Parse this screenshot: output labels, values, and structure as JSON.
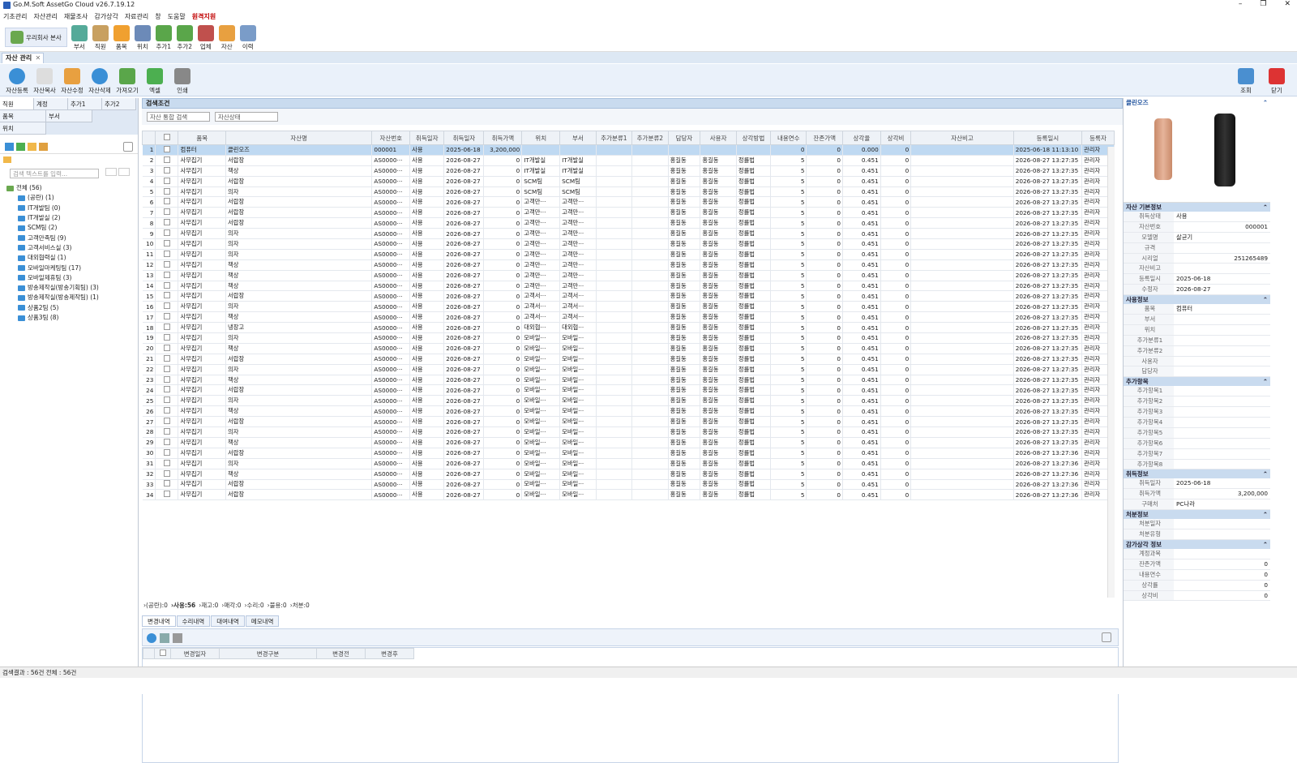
{
  "app": {
    "title": "Go.M.Soft AssetGo Cloud v26.7.19.12"
  },
  "menu": [
    "기초관리",
    "자산관리",
    "재물조사",
    "감가상각",
    "자료관리",
    "창",
    "도움말",
    "원격지원"
  ],
  "toolbar": {
    "company": "우리회사 본사",
    "items": [
      "부서",
      "직원",
      "품목",
      "위치",
      "추가1",
      "추가2",
      "업체",
      "자산",
      "이력"
    ]
  },
  "doc_tab": "자산 관리",
  "sub_toolbar": [
    "자산등록",
    "자산복사",
    "자산수정",
    "자산삭제",
    "가져오기",
    "엑셀",
    "인쇄"
  ],
  "sub_right": [
    "조회",
    "닫기"
  ],
  "left": {
    "tabs": [
      "직원",
      "계정",
      "추가1",
      "추가2"
    ],
    "tabs2": [
      "품목",
      "부서",
      "위치"
    ],
    "search_placeholder": "검색 텍스트를 입력...",
    "tree": [
      "전체 (56)",
      "(공란) (1)",
      "IT개발팀 (0)",
      "IT개발실 (2)",
      "SCM팀 (2)",
      "고객만족팀 (9)",
      "고객서비스실 (3)",
      "대외협력실 (1)",
      "모바일마케팅팀 (17)",
      "모바일제휴팀 (3)",
      "방송제작실(방송기획팀) (3)",
      "방송제작실(방송제작팀) (1)",
      "상품2팀 (5)",
      "상품3팀 (8)"
    ]
  },
  "search": {
    "title": "검색조건",
    "combo1": "자산 통합 검색",
    "combo2": "자산상태"
  },
  "grid": {
    "columns": [
      "",
      "",
      "품목",
      "자산명",
      "자산번호",
      "취득일자",
      "취득일자",
      "취득가액",
      "위치",
      "부서",
      "추가분류1",
      "추가분류2",
      "담당자",
      "사용자",
      "상각방법",
      "내용연수",
      "잔존가액",
      "상각율",
      "상각비",
      "자산비고",
      "등록일시",
      "등록자"
    ],
    "rows": [
      [
        "1",
        "컴퓨터",
        "클린오즈",
        "000001",
        "사용",
        "2025-06-18",
        "3,200,000",
        "",
        "",
        "",
        "",
        "",
        "",
        "",
        "0",
        "0",
        "0.000",
        "0",
        "",
        "2025-06-18 11:13:10",
        "관리자"
      ],
      [
        "2",
        "사무집기",
        "서랍장",
        "AS0000···",
        "사용",
        "2026-08-27",
        "0",
        "IT개발실",
        "IT개발실",
        "",
        "",
        "홍길동",
        "홍길동",
        "정률법",
        "5",
        "0",
        "0.451",
        "0",
        "",
        "2026-08-27 13:27:35",
        "관리자"
      ],
      [
        "3",
        "사무집기",
        "책상",
        "AS0000···",
        "사용",
        "2026-08-27",
        "0",
        "IT개발실",
        "IT개발실",
        "",
        "",
        "홍길동",
        "홍길동",
        "정률법",
        "5",
        "0",
        "0.451",
        "0",
        "",
        "2026-08-27 13:27:35",
        "관리자"
      ],
      [
        "4",
        "사무집기",
        "서랍장",
        "AS0000···",
        "사용",
        "2026-08-27",
        "0",
        "SCM팀",
        "SCM팀",
        "",
        "",
        "홍길동",
        "홍길동",
        "정률법",
        "5",
        "0",
        "0.451",
        "0",
        "",
        "2026-08-27 13:27:35",
        "관리자"
      ],
      [
        "5",
        "사무집기",
        "의자",
        "AS0000···",
        "사용",
        "2026-08-27",
        "0",
        "SCM팀",
        "SCM팀",
        "",
        "",
        "홍길동",
        "홍길동",
        "정률법",
        "5",
        "0",
        "0.451",
        "0",
        "",
        "2026-08-27 13:27:35",
        "관리자"
      ],
      [
        "6",
        "사무집기",
        "서랍장",
        "AS0000···",
        "사용",
        "2026-08-27",
        "0",
        "고객만···",
        "고객만···",
        "",
        "",
        "홍길동",
        "홍길동",
        "정률법",
        "5",
        "0",
        "0.451",
        "0",
        "",
        "2026-08-27 13:27:35",
        "관리자"
      ],
      [
        "7",
        "사무집기",
        "서랍장",
        "AS0000···",
        "사용",
        "2026-08-27",
        "0",
        "고객만···",
        "고객만···",
        "",
        "",
        "홍길동",
        "홍길동",
        "정률법",
        "5",
        "0",
        "0.451",
        "0",
        "",
        "2026-08-27 13:27:35",
        "관리자"
      ],
      [
        "8",
        "사무집기",
        "서랍장",
        "AS0000···",
        "사용",
        "2026-08-27",
        "0",
        "고객만···",
        "고객만···",
        "",
        "",
        "홍길동",
        "홍길동",
        "정률법",
        "5",
        "0",
        "0.451",
        "0",
        "",
        "2026-08-27 13:27:35",
        "관리자"
      ],
      [
        "9",
        "사무집기",
        "의자",
        "AS0000···",
        "사용",
        "2026-08-27",
        "0",
        "고객만···",
        "고객만···",
        "",
        "",
        "홍길동",
        "홍길동",
        "정률법",
        "5",
        "0",
        "0.451",
        "0",
        "",
        "2026-08-27 13:27:35",
        "관리자"
      ],
      [
        "10",
        "사무집기",
        "의자",
        "AS0000···",
        "사용",
        "2026-08-27",
        "0",
        "고객만···",
        "고객만···",
        "",
        "",
        "홍길동",
        "홍길동",
        "정률법",
        "5",
        "0",
        "0.451",
        "0",
        "",
        "2026-08-27 13:27:35",
        "관리자"
      ],
      [
        "11",
        "사무집기",
        "의자",
        "AS0000···",
        "사용",
        "2026-08-27",
        "0",
        "고객만···",
        "고객만···",
        "",
        "",
        "홍길동",
        "홍길동",
        "정률법",
        "5",
        "0",
        "0.451",
        "0",
        "",
        "2026-08-27 13:27:35",
        "관리자"
      ],
      [
        "12",
        "사무집기",
        "책상",
        "AS0000···",
        "사용",
        "2026-08-27",
        "0",
        "고객만···",
        "고객만···",
        "",
        "",
        "홍길동",
        "홍길동",
        "정률법",
        "5",
        "0",
        "0.451",
        "0",
        "",
        "2026-08-27 13:27:35",
        "관리자"
      ],
      [
        "13",
        "사무집기",
        "책상",
        "AS0000···",
        "사용",
        "2026-08-27",
        "0",
        "고객만···",
        "고객만···",
        "",
        "",
        "홍길동",
        "홍길동",
        "정률법",
        "5",
        "0",
        "0.451",
        "0",
        "",
        "2026-08-27 13:27:35",
        "관리자"
      ],
      [
        "14",
        "사무집기",
        "책상",
        "AS0000···",
        "사용",
        "2026-08-27",
        "0",
        "고객만···",
        "고객만···",
        "",
        "",
        "홍길동",
        "홍길동",
        "정률법",
        "5",
        "0",
        "0.451",
        "0",
        "",
        "2026-08-27 13:27:35",
        "관리자"
      ],
      [
        "15",
        "사무집기",
        "서랍장",
        "AS0000···",
        "사용",
        "2026-08-27",
        "0",
        "고객서···",
        "고객서···",
        "",
        "",
        "홍길동",
        "홍길동",
        "정률법",
        "5",
        "0",
        "0.451",
        "0",
        "",
        "2026-08-27 13:27:35",
        "관리자"
      ],
      [
        "16",
        "사무집기",
        "의자",
        "AS0000···",
        "사용",
        "2026-08-27",
        "0",
        "고객서···",
        "고객서···",
        "",
        "",
        "홍길동",
        "홍길동",
        "정률법",
        "5",
        "0",
        "0.451",
        "0",
        "",
        "2026-08-27 13:27:35",
        "관리자"
      ],
      [
        "17",
        "사무집기",
        "책상",
        "AS0000···",
        "사용",
        "2026-08-27",
        "0",
        "고객서···",
        "고객서···",
        "",
        "",
        "홍길동",
        "홍길동",
        "정률법",
        "5",
        "0",
        "0.451",
        "0",
        "",
        "2026-08-27 13:27:35",
        "관리자"
      ],
      [
        "18",
        "사무집기",
        "냉장고",
        "AS0000···",
        "사용",
        "2026-08-27",
        "0",
        "대외협···",
        "대외협···",
        "",
        "",
        "홍길동",
        "홍길동",
        "정률법",
        "5",
        "0",
        "0.451",
        "0",
        "",
        "2026-08-27 13:27:35",
        "관리자"
      ],
      [
        "19",
        "사무집기",
        "의자",
        "AS0000···",
        "사용",
        "2026-08-27",
        "0",
        "모바일···",
        "모바일···",
        "",
        "",
        "홍길동",
        "홍길동",
        "정률법",
        "5",
        "0",
        "0.451",
        "0",
        "",
        "2026-08-27 13:27:35",
        "관리자"
      ],
      [
        "20",
        "사무집기",
        "책상",
        "AS0000···",
        "사용",
        "2026-08-27",
        "0",
        "모바일···",
        "모바일···",
        "",
        "",
        "홍길동",
        "홍길동",
        "정률법",
        "5",
        "0",
        "0.451",
        "0",
        "",
        "2026-08-27 13:27:35",
        "관리자"
      ],
      [
        "21",
        "사무집기",
        "서랍장",
        "AS0000···",
        "사용",
        "2026-08-27",
        "0",
        "모바일···",
        "모바일···",
        "",
        "",
        "홍길동",
        "홍길동",
        "정률법",
        "5",
        "0",
        "0.451",
        "0",
        "",
        "2026-08-27 13:27:35",
        "관리자"
      ],
      [
        "22",
        "사무집기",
        "의자",
        "AS0000···",
        "사용",
        "2026-08-27",
        "0",
        "모바일···",
        "모바일···",
        "",
        "",
        "홍길동",
        "홍길동",
        "정률법",
        "5",
        "0",
        "0.451",
        "0",
        "",
        "2026-08-27 13:27:35",
        "관리자"
      ],
      [
        "23",
        "사무집기",
        "책상",
        "AS0000···",
        "사용",
        "2026-08-27",
        "0",
        "모바일···",
        "모바일···",
        "",
        "",
        "홍길동",
        "홍길동",
        "정률법",
        "5",
        "0",
        "0.451",
        "0",
        "",
        "2026-08-27 13:27:35",
        "관리자"
      ],
      [
        "24",
        "사무집기",
        "서랍장",
        "AS0000···",
        "사용",
        "2026-08-27",
        "0",
        "모바일···",
        "모바일···",
        "",
        "",
        "홍길동",
        "홍길동",
        "정률법",
        "5",
        "0",
        "0.451",
        "0",
        "",
        "2026-08-27 13:27:35",
        "관리자"
      ],
      [
        "25",
        "사무집기",
        "의자",
        "AS0000···",
        "사용",
        "2026-08-27",
        "0",
        "모바일···",
        "모바일···",
        "",
        "",
        "홍길동",
        "홍길동",
        "정률법",
        "5",
        "0",
        "0.451",
        "0",
        "",
        "2026-08-27 13:27:35",
        "관리자"
      ],
      [
        "26",
        "사무집기",
        "책상",
        "AS0000···",
        "사용",
        "2026-08-27",
        "0",
        "모바일···",
        "모바일···",
        "",
        "",
        "홍길동",
        "홍길동",
        "정률법",
        "5",
        "0",
        "0.451",
        "0",
        "",
        "2026-08-27 13:27:35",
        "관리자"
      ],
      [
        "27",
        "사무집기",
        "서랍장",
        "AS0000···",
        "사용",
        "2026-08-27",
        "0",
        "모바일···",
        "모바일···",
        "",
        "",
        "홍길동",
        "홍길동",
        "정률법",
        "5",
        "0",
        "0.451",
        "0",
        "",
        "2026-08-27 13:27:35",
        "관리자"
      ],
      [
        "28",
        "사무집기",
        "의자",
        "AS0000···",
        "사용",
        "2026-08-27",
        "0",
        "모바일···",
        "모바일···",
        "",
        "",
        "홍길동",
        "홍길동",
        "정률법",
        "5",
        "0",
        "0.451",
        "0",
        "",
        "2026-08-27 13:27:35",
        "관리자"
      ],
      [
        "29",
        "사무집기",
        "책상",
        "AS0000···",
        "사용",
        "2026-08-27",
        "0",
        "모바일···",
        "모바일···",
        "",
        "",
        "홍길동",
        "홍길동",
        "정률법",
        "5",
        "0",
        "0.451",
        "0",
        "",
        "2026-08-27 13:27:35",
        "관리자"
      ],
      [
        "30",
        "사무집기",
        "서랍장",
        "AS0000···",
        "사용",
        "2026-08-27",
        "0",
        "모바일···",
        "모바일···",
        "",
        "",
        "홍길동",
        "홍길동",
        "정률법",
        "5",
        "0",
        "0.451",
        "0",
        "",
        "2026-08-27 13:27:36",
        "관리자"
      ],
      [
        "31",
        "사무집기",
        "의자",
        "AS0000···",
        "사용",
        "2026-08-27",
        "0",
        "모바일···",
        "모바일···",
        "",
        "",
        "홍길동",
        "홍길동",
        "정률법",
        "5",
        "0",
        "0.451",
        "0",
        "",
        "2026-08-27 13:27:36",
        "관리자"
      ],
      [
        "32",
        "사무집기",
        "책상",
        "AS0000···",
        "사용",
        "2026-08-27",
        "0",
        "모바일···",
        "모바일···",
        "",
        "",
        "홍길동",
        "홍길동",
        "정률법",
        "5",
        "0",
        "0.451",
        "0",
        "",
        "2026-08-27 13:27:36",
        "관리자"
      ],
      [
        "33",
        "사무집기",
        "서랍장",
        "AS0000···",
        "사용",
        "2026-08-27",
        "0",
        "모바일···",
        "모바일···",
        "",
        "",
        "홍길동",
        "홍길동",
        "정률법",
        "5",
        "0",
        "0.451",
        "0",
        "",
        "2026-08-27 13:27:36",
        "관리자"
      ],
      [
        "34",
        "사무집기",
        "서랍장",
        "AS0000···",
        "사용",
        "2026-08-27",
        "0",
        "모바일···",
        "모바일···",
        "",
        "",
        "홍길동",
        "홍길동",
        "정률법",
        "5",
        "0",
        "0.451",
        "0",
        "",
        "2026-08-27 13:27:36",
        "관리자"
      ]
    ]
  },
  "status_filters": [
    "(공란):0",
    "사용:56",
    "재고:0",
    "매각:0",
    "수리:0",
    "불용:0",
    "처분:0"
  ],
  "bottom_tabs": [
    "변경내역",
    "수리내역",
    "대여내역",
    "메모내역"
  ],
  "bottom_columns": [
    "변경일자",
    "변경구분",
    "변경전",
    "변경후"
  ],
  "right": {
    "title": "클린오즈",
    "sections": [
      {
        "title": "자산 기본정보",
        "rows": [
          [
            "취득상태",
            "사용"
          ],
          [
            "자산번호",
            "000001"
          ],
          [
            "모델명",
            "살균기"
          ],
          [
            "규격",
            ""
          ],
          [
            "시리얼",
            "251265489"
          ],
          [
            "자산비고",
            ""
          ],
          [
            "등록일시",
            "2025-06-18"
          ],
          [
            "수정자",
            "2026-08-27"
          ]
        ]
      },
      {
        "title": "사용정보",
        "rows": [
          [
            "품목",
            "컴퓨터"
          ],
          [
            "부서",
            ""
          ],
          [
            "위치",
            ""
          ],
          [
            "추가분류1",
            ""
          ],
          [
            "추가분류2",
            ""
          ],
          [
            "사용자",
            ""
          ],
          [
            "담당자",
            ""
          ]
        ]
      },
      {
        "title": "추가항목",
        "rows": [
          [
            "추가항목1",
            ""
          ],
          [
            "추가항목2",
            ""
          ],
          [
            "추가항목3",
            ""
          ],
          [
            "추가항목4",
            ""
          ],
          [
            "추가항목5",
            ""
          ],
          [
            "추가항목6",
            ""
          ],
          [
            "추가항목7",
            ""
          ],
          [
            "추가항목8",
            ""
          ]
        ]
      },
      {
        "title": "취득정보",
        "rows": [
          [
            "취득일자",
            "2025-06-18"
          ],
          [
            "취득가액",
            "3,200,000"
          ],
          [
            "구매처",
            "PC나라"
          ]
        ]
      },
      {
        "title": "처분정보",
        "rows": [
          [
            "처분일자",
            ""
          ],
          [
            "처분유형",
            ""
          ]
        ]
      },
      {
        "title": "감가상각 정보",
        "rows": [
          [
            "계정과목",
            ""
          ],
          [
            "잔존가액",
            "0"
          ],
          [
            "내용연수",
            "0"
          ],
          [
            "상각률",
            "0"
          ],
          [
            "상각비",
            "0"
          ]
        ]
      }
    ]
  },
  "statusbar": "검색결과 : 56건   전체 : 56건"
}
